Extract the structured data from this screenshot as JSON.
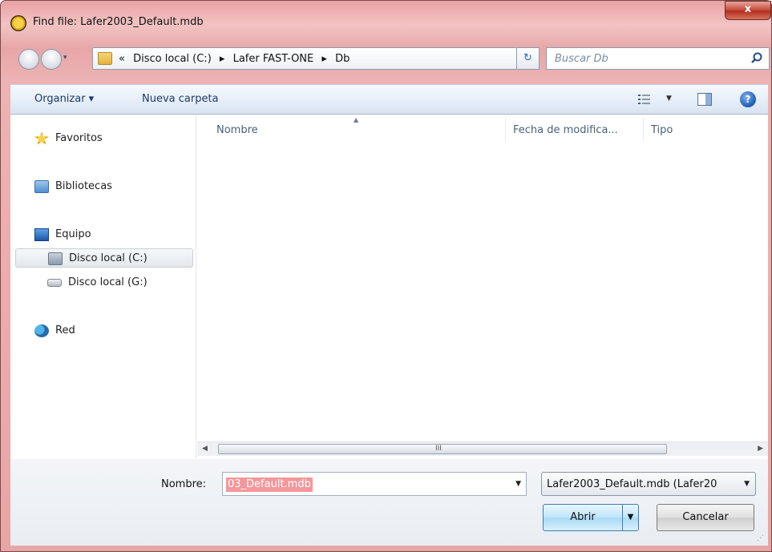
{
  "window": {
    "title": "Find file: Lafer2003_Default.mdb",
    "close_label": "x"
  },
  "address": {
    "prefix": "«",
    "crumbs": [
      "Disco local (C:)",
      "Lafer FAST-ONE",
      "Db"
    ],
    "separator": "▸",
    "search_placeholder": "Buscar Db"
  },
  "toolbar": {
    "organize_label": "Organizar ▾",
    "new_folder_label": "Nueva carpeta",
    "help_label": "?"
  },
  "sidebar": {
    "items": [
      {
        "label": "Favoritos",
        "icon": "star-icon"
      },
      {
        "label": "Bibliotecas",
        "icon": "libraries-icon"
      },
      {
        "label": "Equipo",
        "icon": "computer-icon"
      },
      {
        "label": "Disco local (C:)",
        "icon": "drive-c-icon",
        "selected": true
      },
      {
        "label": "Disco local (G:)",
        "icon": "drive-g-icon"
      },
      {
        "label": "Red",
        "icon": "network-icon"
      }
    ]
  },
  "files": {
    "columns": [
      "Nombre",
      "Fecha de modifica...",
      "Tipo"
    ],
    "scroll_grip": "III"
  },
  "bottom": {
    "name_label": "Nombre:",
    "name_value": "03_Default.mdb",
    "filter_value": "Lafer2003_Default.mdb (Lafer20",
    "open_label": "Abrir",
    "cancel_label": "Cancelar"
  },
  "colors": {
    "chrome": "#e9a2a4",
    "selection": "#f4979b",
    "accent": "#3c7fb1"
  }
}
